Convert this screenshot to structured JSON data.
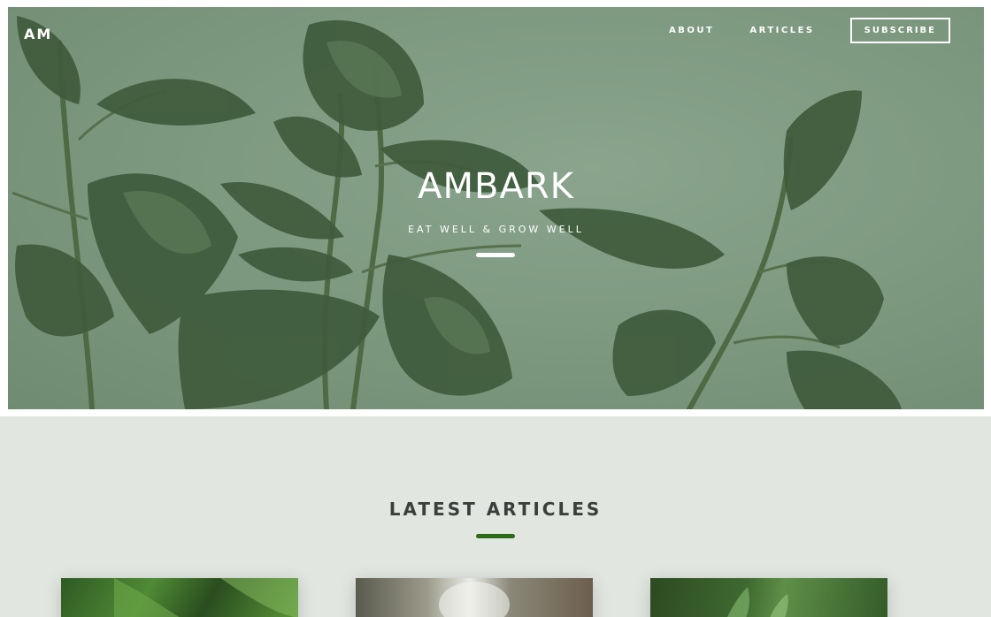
{
  "header": {
    "logo": "AM",
    "nav": {
      "about": "ABOUT",
      "articles": "ARTICLES",
      "subscribe": "SUBSCRIBE"
    }
  },
  "hero": {
    "title": "AMBARK",
    "tagline": "EAT WELL & GROW WELL",
    "background_image": "rubber plant leaves on sage green background"
  },
  "articles": {
    "title": "LATEST ARTICLES",
    "cards": [
      {
        "image": "green leaves close-up"
      },
      {
        "image": "blurred bowl"
      },
      {
        "image": "green seedlings"
      }
    ]
  },
  "colors": {
    "hero_bg": "#7e9a81",
    "section_bg": "#e2e6e1",
    "accent": "#2b6a16",
    "text_dark": "#3b3f3c"
  }
}
